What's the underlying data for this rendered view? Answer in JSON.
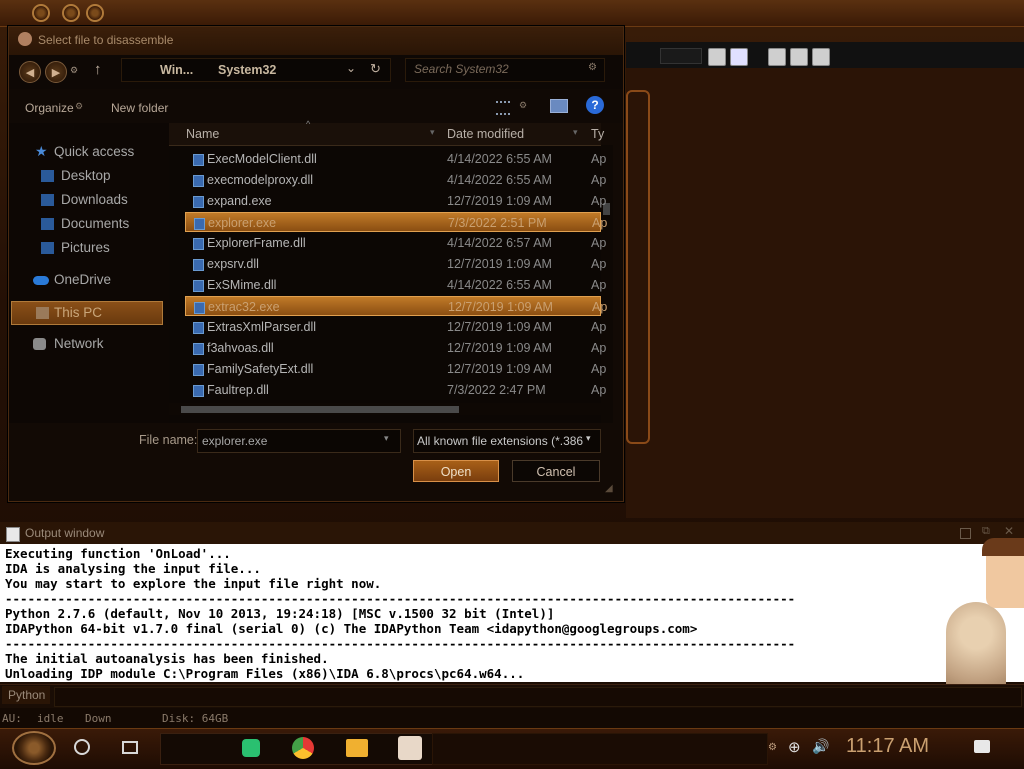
{
  "dialog": {
    "title": "Select file to disassemble",
    "path": [
      "Win...",
      "System32"
    ],
    "search_placeholder": "Search System32",
    "organize_label": "Organize",
    "new_folder_label": "New folder",
    "help_label": "?",
    "columns": {
      "name": "Name",
      "date": "Date modified",
      "type": "Ty"
    },
    "nav": [
      {
        "label": "Quick access",
        "icon": "star-icon"
      },
      {
        "label": "Desktop",
        "icon": "desktop-folder-icon"
      },
      {
        "label": "Downloads",
        "icon": "downloads-folder-icon"
      },
      {
        "label": "Documents",
        "icon": "documents-folder-icon"
      },
      {
        "label": "Pictures",
        "icon": "pictures-folder-icon"
      },
      {
        "label": "OneDrive",
        "icon": "cloud-icon"
      },
      {
        "label": "This PC",
        "icon": "computer-icon"
      },
      {
        "label": "Network",
        "icon": "network-icon"
      }
    ],
    "files": [
      {
        "name": "ExecModelClient.dll",
        "date": "4/14/2022 6:55 AM",
        "type": "Ap"
      },
      {
        "name": "execmodelproxy.dll",
        "date": "4/14/2022 6:55 AM",
        "type": "Ap"
      },
      {
        "name": "expand.exe",
        "date": "12/7/2019 1:09 AM",
        "type": "Ap"
      },
      {
        "name": "explorer.exe",
        "date": "7/3/2022 2:51 PM",
        "type": "Ap"
      },
      {
        "name": "ExplorerFrame.dll",
        "date": "4/14/2022 6:57 AM",
        "type": "Ap"
      },
      {
        "name": "expsrv.dll",
        "date": "12/7/2019 1:09 AM",
        "type": "Ap"
      },
      {
        "name": "ExSMime.dll",
        "date": "4/14/2022 6:55 AM",
        "type": "Ap"
      },
      {
        "name": "extrac32.exe",
        "date": "12/7/2019 1:09 AM",
        "type": "Ap"
      },
      {
        "name": "ExtrasXmlParser.dll",
        "date": "12/7/2019 1:09 AM",
        "type": "Ap"
      },
      {
        "name": "f3ahvoas.dll",
        "date": "12/7/2019 1:09 AM",
        "type": "Ap"
      },
      {
        "name": "FamilySafetyExt.dll",
        "date": "12/7/2019 1:09 AM",
        "type": "Ap"
      },
      {
        "name": "Faultrep.dll",
        "date": "7/3/2022 2:47 PM",
        "type": "Ap"
      }
    ],
    "file_name_label": "File name:",
    "file_name_value": "explorer.exe",
    "file_type_value": "All known file extensions (*.386",
    "open_label": "Open",
    "cancel_label": "Cancel"
  },
  "output": {
    "title": "Output window",
    "lines": "Executing function 'OnLoad'...\nIDA is analysing the input file...\nYou may start to explore the input file right now.\n---------------------------------------------------------------------------------------------------------\nPython 2.7.6 (default, Nov 10 2013, 19:24:18) [MSC v.1500 32 bit (Intel)]\nIDAPython 64-bit v1.7.0 final (serial 0) (c) The IDAPython Team <idapython@googlegroups.com>\n---------------------------------------------------------------------------------------------------------\nThe initial autoanalysis has been finished.\nUnloading IDP module C:\\Program Files (x86)\\IDA 6.8\\procs\\pc64.w64..."
  },
  "python_tab": "Python",
  "status": {
    "au": "AU:",
    "state": "idle",
    "dir": "Down",
    "disk": "Disk: 64GB"
  },
  "taskbar": {
    "time": "11:17 AM"
  },
  "colors": {
    "accent": "#b86a1c",
    "selection": "#c07a28",
    "background": "#241005"
  }
}
